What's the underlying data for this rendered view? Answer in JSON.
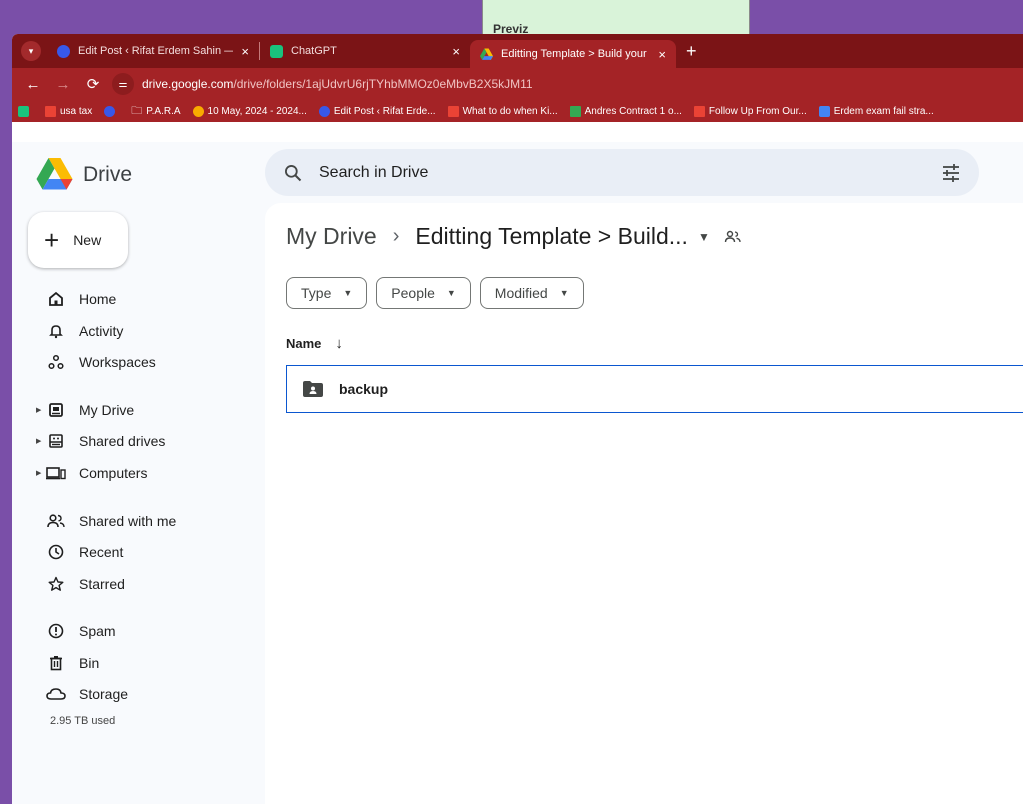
{
  "background_window": {
    "title": "Previz"
  },
  "tabs": [
    {
      "label": "Edit Post ‹ Rifat Erdem Sahin —",
      "icon": "wordpress-icon",
      "close": "×"
    },
    {
      "label": "ChatGPT",
      "icon": "chatgpt-icon",
      "close": "×"
    },
    {
      "label": "Editting Template > Build your l",
      "icon": "google-drive-icon",
      "close": "×"
    }
  ],
  "new_tab": "+",
  "address": {
    "host": "drive.google.com",
    "path": "/drive/folders/1ajUdvrU6rjTYhbMMOz0eMbvB2X5kJM11"
  },
  "bookmarks": [
    {
      "label": "",
      "icon": "chatgpt-icon",
      "color": "#19c37d"
    },
    {
      "label": "usa tax",
      "icon": "gmail-icon",
      "color": "#ea4335"
    },
    {
      "label": "",
      "icon": "wordpress-icon",
      "color": "#3858e9"
    },
    {
      "label": "P.A.R.A",
      "icon": "folder-icon",
      "color": "#ffffff"
    },
    {
      "label": "10 May, 2024 - 2024...",
      "icon": "star-icon",
      "color": "#f9ab00"
    },
    {
      "label": "Edit Post ‹ Rifat Erde...",
      "icon": "wordpress-icon",
      "color": "#3858e9"
    },
    {
      "label": "What to do when Ki...",
      "icon": "gmail-icon",
      "color": "#ea4335"
    },
    {
      "label": "Andres Contract 1 o...",
      "icon": "google-drive-icon",
      "color": "#34a853"
    },
    {
      "label": "Follow Up From Our...",
      "icon": "gmail-icon",
      "color": "#ea4335"
    },
    {
      "label": "Erdem exam fail stra...",
      "icon": "calendar-icon",
      "color": "#4285f4"
    }
  ],
  "app": {
    "name": "Drive"
  },
  "search": {
    "placeholder": "Search in Drive"
  },
  "new_button": {
    "label": "New"
  },
  "nav": {
    "home": "Home",
    "activity": "Activity",
    "workspaces": "Workspaces",
    "my_drive": "My Drive",
    "shared_drives": "Shared drives",
    "computers": "Computers",
    "shared_with_me": "Shared with me",
    "recent": "Recent",
    "starred": "Starred",
    "spam": "Spam",
    "bin": "Bin",
    "storage": "Storage",
    "storage_used": "2.95 TB used"
  },
  "breadcrumb": {
    "root": "My Drive",
    "separator": "›",
    "current": "Editting Template > Build..."
  },
  "filters": [
    {
      "label": "Type"
    },
    {
      "label": "People"
    },
    {
      "label": "Modified"
    }
  ],
  "columns": {
    "name": "Name",
    "sort_icon": "↓"
  },
  "files": [
    {
      "name": "backup",
      "icon": "shared-folder-icon"
    }
  ],
  "colors": {
    "tab_bar": "#7b1416",
    "toolbar": "#a42326",
    "accent": "#0b57d0",
    "surface": "#f8fafd"
  }
}
